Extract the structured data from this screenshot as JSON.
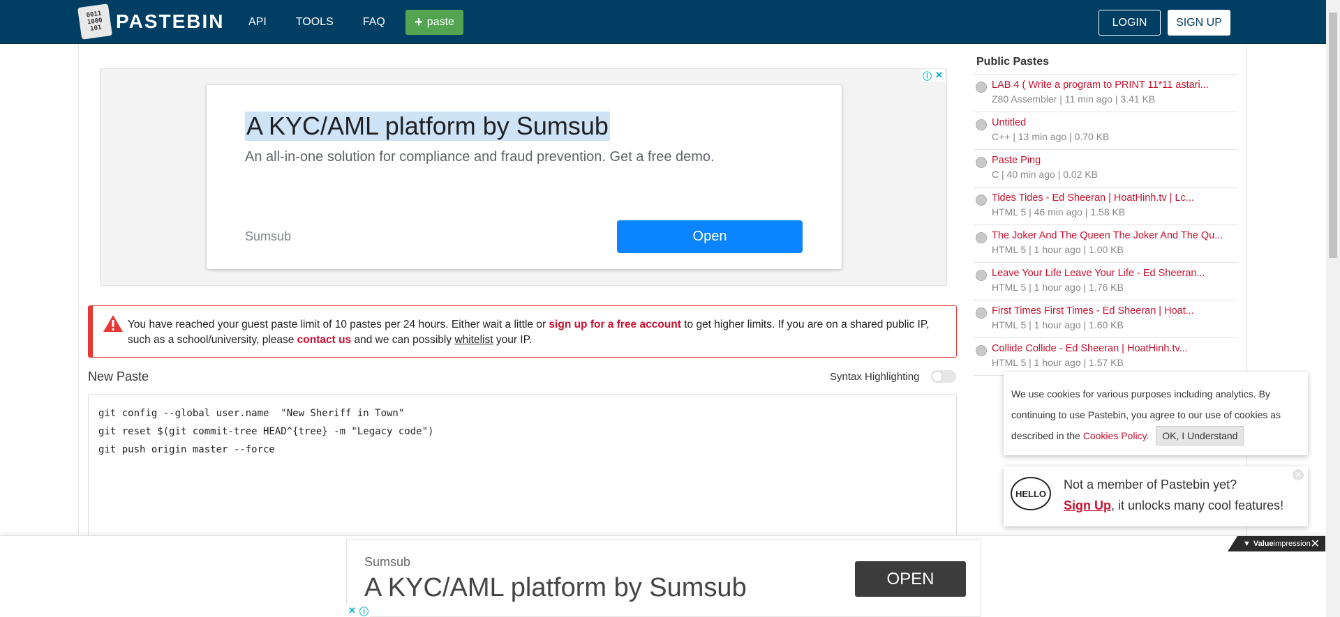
{
  "header": {
    "logo_digits": "0011\n1000\n101",
    "logo_text": "PASTEBIN",
    "nav": [
      "API",
      "TOOLS",
      "FAQ"
    ],
    "paste_button": "paste",
    "login": "LOGIN",
    "signup": "SIGN UP"
  },
  "top_ad": {
    "title": "A KYC/AML platform by Sumsub",
    "description": "An all-in-one solution for compliance and fraud prevention. Get a free demo.",
    "brand": "Sumsub",
    "button": "Open"
  },
  "warning": {
    "part1": "You have reached your guest paste limit of 10 pastes per 24 hours. Either wait a little or ",
    "link1": "sign up for a free account",
    "part2": " to get higher limits. If you are on a shared public IP, such as a school/university, please ",
    "link2": "contact us",
    "part3": " and we can possibly ",
    "link3": "whitelist",
    "part4": " your IP."
  },
  "new_paste": {
    "title": "New Paste",
    "syntax_label": "Syntax Highlighting",
    "code_lines": [
      "git config --global user.name  \"New Sheriff in Town\"",
      "git reset $(git commit-tree HEAD^{tree} -m \"Legacy code\")",
      "git push origin master --force"
    ]
  },
  "public_pastes": {
    "title": "Public Pastes",
    "items": [
      {
        "name": "LAB 4 ( Write a program to PRINT 11*11 astari...",
        "meta": "Z80 Assembler | 11 min ago | 3.41 KB"
      },
      {
        "name": "Untitled",
        "meta": "C++ | 13 min ago | 0.70 KB"
      },
      {
        "name": "Paste Ping",
        "meta": "C | 40 min ago | 0.02 KB"
      },
      {
        "name": "Tides Tides - Ed Sheeran | HoatHinh.tv | Lc...",
        "meta": "HTML 5 | 46 min ago | 1.58 KB"
      },
      {
        "name": "The Joker And The Queen The Joker And The Qu...",
        "meta": "HTML 5 | 1 hour ago | 1.00 KB"
      },
      {
        "name": "Leave Your Life Leave Your Life - Ed Sheeran...",
        "meta": "HTML 5 | 1 hour ago | 1.76 KB"
      },
      {
        "name": "First Times First Times - Ed Sheeran | Hoat...",
        "meta": "HTML 5 | 1 hour ago | 1.60 KB"
      },
      {
        "name": "Collide Collide - Ed Sheeran | HoatHinh.tv...",
        "meta": "HTML 5 | 1 hour ago | 1.57 KB"
      }
    ]
  },
  "cookie": {
    "text": "We use cookies for various purposes including analytics. By continuing to use Pastebin, you agree to our use of cookies as described in the ",
    "link": "Cookies Policy",
    "after": ".",
    "button": "OK, I Understand"
  },
  "member_popup": {
    "badge": "HELLO",
    "line1": "Not a member of Pastebin yet?",
    "signup": "Sign Up",
    "line2_rest": ", it unlocks many cool features!"
  },
  "bottom_ad": {
    "badge_bold": "Value",
    "badge_rest": "impression",
    "brand": "Sumsub",
    "title": "A KYC/AML platform by Sumsub",
    "button": "OPEN"
  },
  "colors": {
    "header": "#003e63",
    "paste_button": "#53a451",
    "accent_red": "#c8102e",
    "ad_button": "#0a84ff"
  }
}
